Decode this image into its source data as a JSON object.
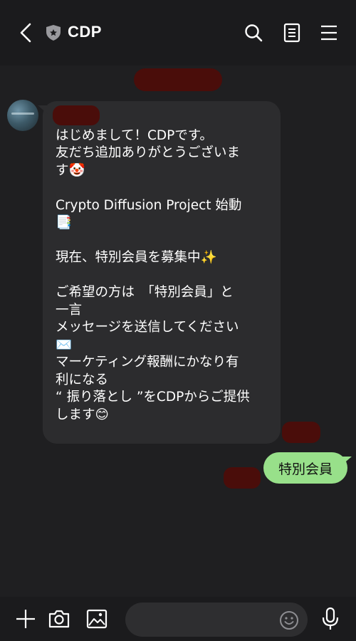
{
  "header": {
    "title": "CDP",
    "icons": [
      "back-arrow-icon",
      "shield-icon",
      "search-icon",
      "notes-icon",
      "menu-icon"
    ]
  },
  "chat": {
    "received_message": "  さん\nはじめまして！CDPです。\n友だち追加ありがとうございま\nす🤡\n\nCrypto Diffusion Project 始動\n📑\n\n現在、特別会員を募集中✨\n\nご希望の方は　「特別会員」と\n一言\nメッセージを送信してください\n✉️\nマーケティング報酬にかなり有\n利になる\n“ 振り落とし ”をCDPからご提供\nします😊",
    "sent_message": "特別会員"
  },
  "composer": {
    "input_value": "",
    "icons": [
      "plus-icon",
      "camera-icon",
      "image-icon",
      "emoji-icon",
      "microphone-icon"
    ]
  },
  "colors": {
    "background": "#1f1f21",
    "bubble_received": "#2c2c2e",
    "bubble_sent": "#98e08a",
    "redaction": "#4a0d0a"
  }
}
